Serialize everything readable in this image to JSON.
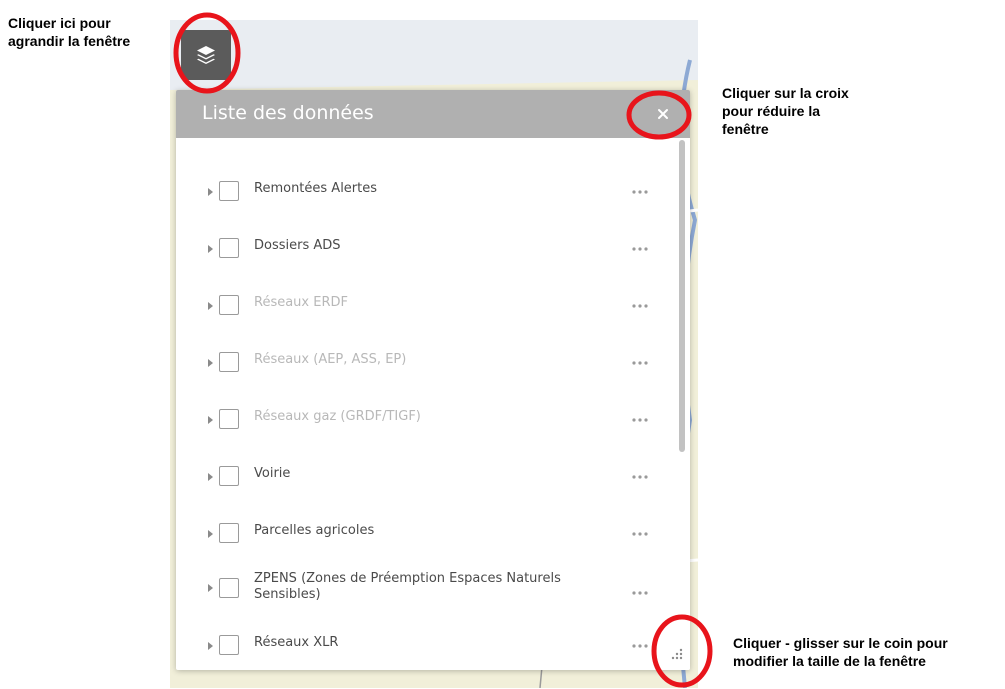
{
  "annotations": {
    "expand": "Cliquer ici pour\nagrandir la fenêtre",
    "close": "Cliquer sur la croix\npour réduire  la\nfenêtre",
    "resize": "Cliquer - glisser sur le coin pour\nmodifier la taille de la fenêtre"
  },
  "panel": {
    "title": "Liste des données",
    "layers": [
      {
        "label": "Remontées Alertes",
        "disabled": false
      },
      {
        "label": "Dossiers ADS",
        "disabled": false
      },
      {
        "label": "Réseaux ERDF",
        "disabled": true
      },
      {
        "label": "Réseaux (AEP, ASS, EP)",
        "disabled": true
      },
      {
        "label": "Réseaux gaz (GRDF/TIGF)",
        "disabled": true
      },
      {
        "label": "Voirie",
        "disabled": false
      },
      {
        "label": "Parcelles agricoles",
        "disabled": false
      },
      {
        "label": "ZPENS (Zones de Préemption Espaces Naturels Sensibles)",
        "disabled": false
      },
      {
        "label": "Réseaux XLR",
        "disabled": false
      }
    ]
  },
  "icons": {
    "layers_button": "layers-icon",
    "close": "close-icon",
    "more": "more-options-icon",
    "resize": "resize-handle-icon"
  },
  "colors": {
    "header": "#b0b0b0",
    "layers_button": "#5b5b5b",
    "highlight_circle": "#e8141b",
    "disabled_text": "#b8b8b8"
  }
}
